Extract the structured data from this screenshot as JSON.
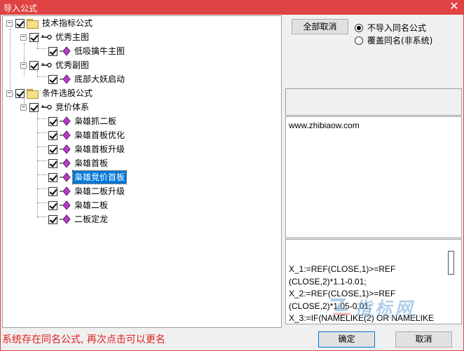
{
  "window": {
    "title": "导入公式",
    "close_label": "✕"
  },
  "tree": {
    "root1": {
      "label": "技术指标公式"
    },
    "group1": {
      "label": "优秀主图"
    },
    "item1": {
      "label": "低吸擒牛主图"
    },
    "group2": {
      "label": "优秀副图"
    },
    "item2": {
      "label": "底部大妖启动"
    },
    "root2": {
      "label": "条件选股公式"
    },
    "group3": {
      "label": "竞价体系"
    },
    "items3": [
      "枭雄抓二板",
      "枭雄首板优化",
      "枭雄首板升级",
      "枭雄首板",
      "枭雄竞价首板",
      "枭雄二板升级",
      "枭雄二板",
      "二板定龙"
    ],
    "selected_item": "枭雄竞价首板",
    "expander_minus": "−"
  },
  "buttons": {
    "cancel_all": "全部取消",
    "ok": "确定",
    "cancel": "取消"
  },
  "options": {
    "radio1": "不导入同名公式",
    "radio2": "覆盖同名(非系统)",
    "selected": "不导入同名公式"
  },
  "info": {
    "url": "www.zhibiaow.com"
  },
  "code": {
    "text": "X_1:=REF(CLOSE,1)>=REF\n(CLOSE,2)*1.1-0.01;\nX_2:=REF(CLOSE,1)>=REF\n(CLOSE,2)*1.05-0.01;\nX_3:=IF(NAMELIKE(2) OR NAMELIKE"
  },
  "watermark": {
    "text": "指标网",
    "sub": "WWW.ZHIBIAOW.COM"
  },
  "status": {
    "message": "系统存在同名公式, 再次点击可以更名"
  },
  "colors": {
    "titlebar": "#e04343",
    "status_text": "#e02020",
    "selection": "#0078d7",
    "diamond": "#b040c0"
  }
}
